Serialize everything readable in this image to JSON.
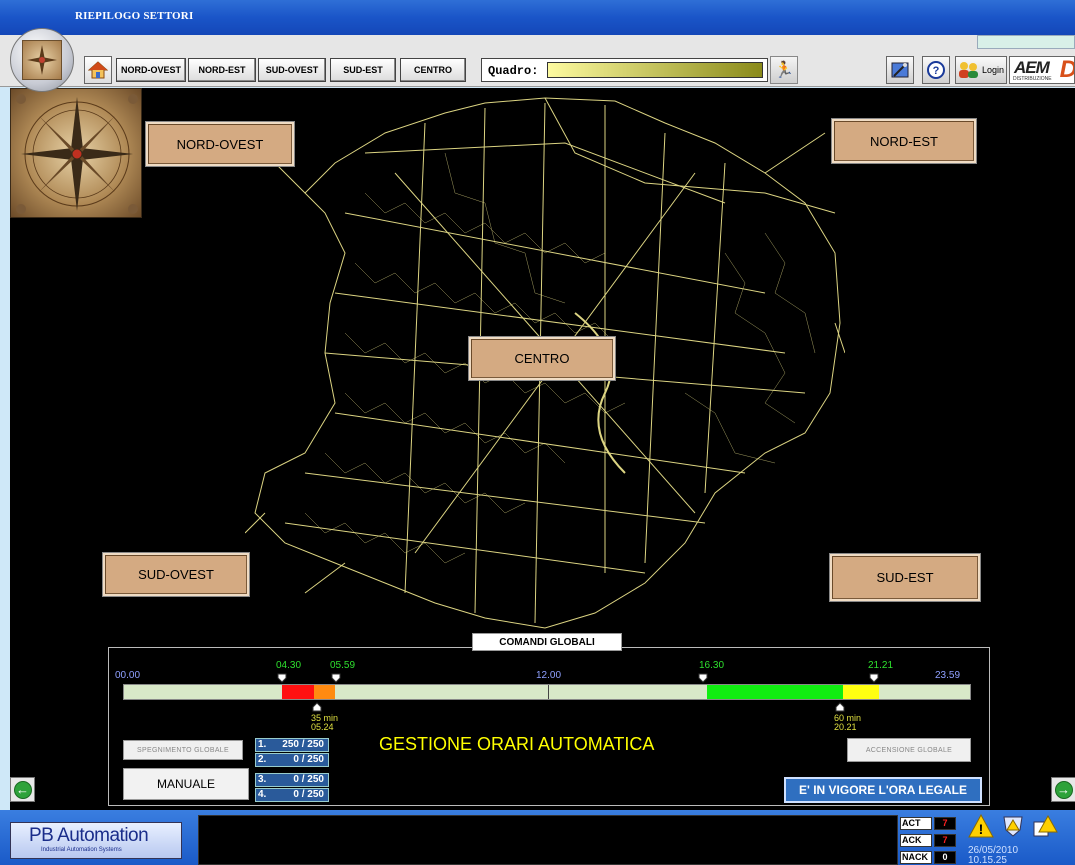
{
  "window": {
    "title": "RIEPILOGO SETTORI"
  },
  "toolbar": {
    "home_icon": "home-icon",
    "buttons": [
      "NORD-OVEST",
      "NORD-EST",
      "SUD-OVEST",
      "SUD-EST",
      "CENTRO"
    ],
    "quadro_label": "Quadro:",
    "quadro_value": "",
    "login_label": "Login",
    "brand": "AEM",
    "brand_sub": "DISTRIBUZIONE",
    "brand_letter": "D"
  },
  "map": {
    "sectors": {
      "nord_ovest": "NORD-OVEST",
      "nord_est": "NORD-EST",
      "centro": "CENTRO",
      "sud_ovest": "SUD-OVEST",
      "sud_est": "SUD-EST"
    },
    "map_color": "#e8e08a"
  },
  "comandi": {
    "title": "COMANDI GLOBALI",
    "scale": {
      "start": "00.00",
      "mid": "12.00",
      "end": "23.59"
    },
    "markers_top": [
      "04.30",
      "05.59",
      "16.30",
      "21.21"
    ],
    "markers_bottom": [
      {
        "min": "35 min",
        "time": "05.24"
      },
      {
        "min": "60 min",
        "time": "20.21"
      }
    ],
    "status": "GESTIONE ORARI AUTOMATICA",
    "spegnimento": "SPEGNIMENTO GLOBALE",
    "accensione": "ACCENSIONE GLOBALE",
    "manuale": "MANUALE",
    "counts": [
      {
        "n": "1.",
        "v": "250 / 250"
      },
      {
        "n": "2.",
        "v": "0 / 250"
      },
      {
        "n": "3.",
        "v": "0 / 250"
      },
      {
        "n": "4.",
        "v": "0 / 250"
      }
    ],
    "legal": "E' IN VIGORE L'ORA LEGALE"
  },
  "bottom": {
    "logo_main": "PB Automation",
    "logo_sub": "Industrial Automation Systems",
    "alarms": [
      {
        "k": "ACT",
        "v": "7",
        "color": "#ff2020"
      },
      {
        "k": "ACK",
        "v": "7",
        "color": "#ff2020"
      },
      {
        "k": "NACK",
        "v": "0",
        "color": "#ffffff"
      }
    ],
    "date": "26/05/2010",
    "time": "10.15.25"
  }
}
